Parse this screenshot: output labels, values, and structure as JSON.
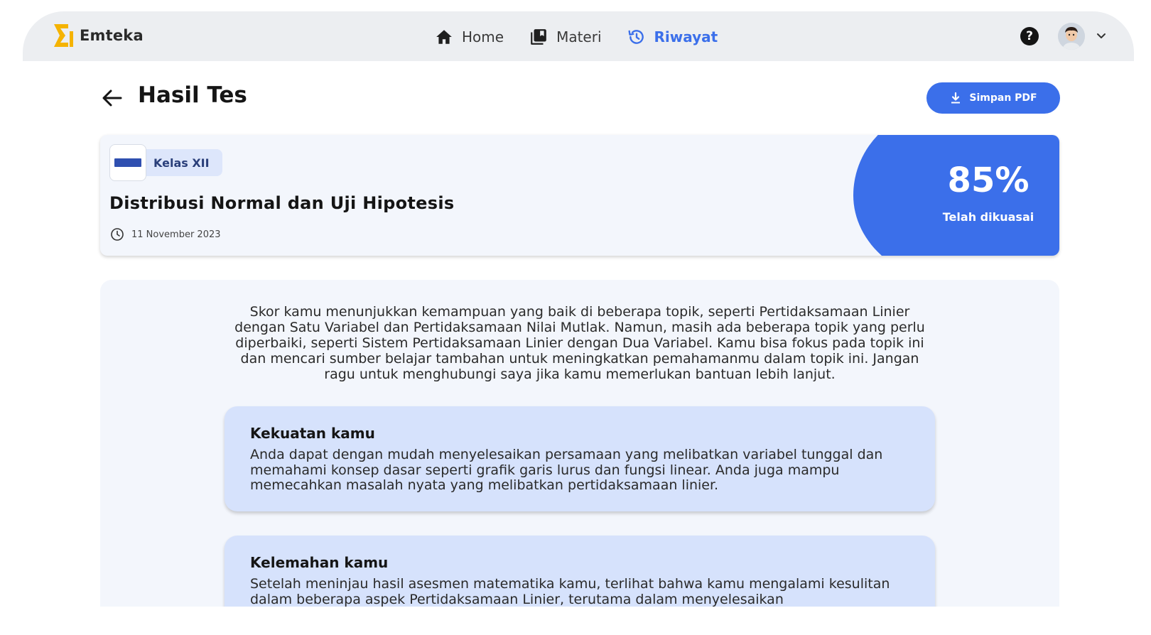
{
  "nav": {
    "brand_name": "Emteka",
    "items": [
      {
        "label": "Home",
        "icon": "home-icon"
      },
      {
        "label": "Materi",
        "icon": "library-icon"
      },
      {
        "label": "Riwayat",
        "icon": "history-icon"
      }
    ],
    "active_item": "Riwayat",
    "accent_color": "#3b6fea"
  },
  "header": {
    "title": "Hasil Tes",
    "pdf_button_label": "Simpan PDF"
  },
  "test": {
    "class_label": "Kelas XII",
    "title": "Distribusi Normal dan Uji Hipotesis",
    "date": "11 November 2023",
    "score": "85%",
    "score_caption": "Telah dikuasai"
  },
  "feedback": {
    "summary": "Skor kamu menunjukkan kemampuan yang baik di beberapa topik, seperti Pertidaksamaan Linier dengan Satu Variabel dan Pertidaksamaan Nilai Mutlak. Namun, masih ada beberapa topik yang perlu diperbaiki, seperti Sistem Pertidaksamaan Linier dengan Dua Variabel. Kamu bisa fokus pada topik ini dan mencari sumber belajar tambahan untuk meningkatkan pemahamanmu dalam topik ini. Jangan ragu untuk menghubungi saya jika kamu memerlukan bantuan lebih lanjut.",
    "strength_title": "Kekuatan kamu",
    "strength_body": "Anda dapat dengan mudah menyelesaikan persamaan yang melibatkan variabel tunggal dan memahami konsep dasar seperti grafik garis lurus dan fungsi linear. Anda juga mampu memecahkan masalah nyata yang melibatkan pertidaksamaan linier.",
    "weakness_title": "Kelemahan kamu",
    "weakness_body": "Setelah meninjau hasil asesmen matematika kamu, terlihat bahwa kamu mengalami kesulitan dalam beberapa aspek Pertidaksamaan Linier, terutama dalam menyelesaikan"
  }
}
